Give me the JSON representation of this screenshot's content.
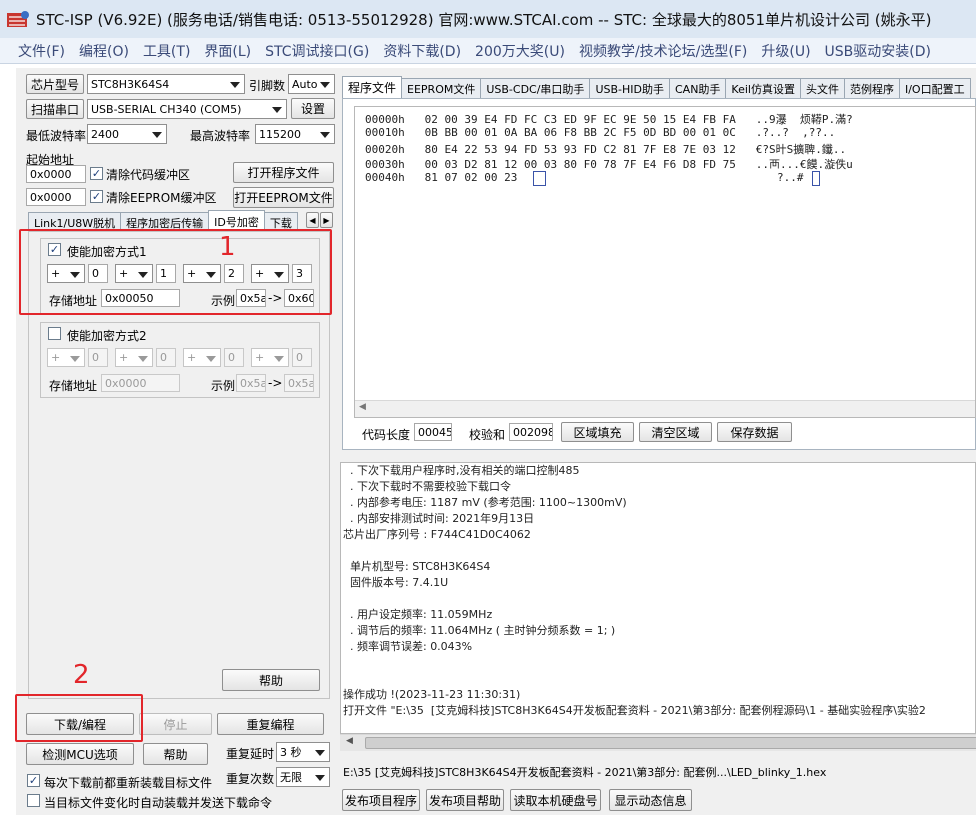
{
  "window": {
    "title": "STC-ISP (V6.92E) (服务电话/销售电话: 0513-55012928) 官网:www.STCAI.com  -- STC: 全球最大的8051单片机设计公司 (姚永平)"
  },
  "menu": [
    "文件(F)",
    "编程(O)",
    "工具(T)",
    "界面(L)",
    "STC调试接口(G)",
    "资料下载(D)",
    "200万大奖(U)",
    "视频教学/技术论坛/选型(F)",
    "升级(U)",
    "USB驱动安装(D)"
  ],
  "left": {
    "chip_label": "芯片型号",
    "chip_value": "STC8H3K64S4",
    "pin_label": "引脚数",
    "pin_value": "Auto",
    "scan_btn": "扫描串口",
    "port_value": "USB-SERIAL CH340 (COM5)",
    "settings_btn": "设置",
    "min_baud_label": "最低波特率",
    "min_baud": "2400",
    "max_baud_label": "最高波特率",
    "max_baud": "115200",
    "start_addr_label": "起始地址",
    "code_addr": "0x0000",
    "clear_code": "清除代码缓冲区",
    "open_prog": "打开程序文件",
    "eeprom_addr": "0x0000",
    "clear_eeprom": "清除EEPROM缓冲区",
    "open_eeprom": "打开EEPROM文件",
    "tabs": [
      "Link1/U8W脱机",
      "程序加密后传输",
      "ID号加密",
      "下载"
    ],
    "enc1": {
      "label": "使能加密方式1",
      "ops": [
        "+",
        "+",
        "+",
        "+"
      ],
      "vals": [
        "0",
        "1",
        "2",
        "3"
      ],
      "addr_label": "存储地址",
      "addr": "0x00050",
      "example_label": "示例",
      "ex_from": "0x5a",
      "arrow": "->",
      "ex_to": "0x60"
    },
    "enc2": {
      "label": "使能加密方式2",
      "ops": [
        "+",
        "+",
        "+",
        "+"
      ],
      "vals": [
        "0",
        "0",
        "0",
        "0"
      ],
      "addr_label": "存储地址",
      "addr": "0x0000",
      "example_label": "示例",
      "ex_from": "0x5a",
      "arrow": "->",
      "ex_to": "0x5a"
    },
    "help_btn": "帮助",
    "download_btn": "下载/编程",
    "stop_btn": "停止",
    "repeat_btn": "重复编程",
    "detect_btn": "检测MCU选项",
    "help2_btn": "帮助",
    "delay_label": "重复延时",
    "delay_value": "3 秒",
    "count_label": "重复次数",
    "count_value": "无限",
    "reload_label": "每次下载前都重新装载目标文件",
    "auto_label": "当目标文件变化时自动装载并发送下载命令"
  },
  "annotations": {
    "one": "1",
    "two": "2"
  },
  "right": {
    "tabs": [
      "程序文件",
      "EEPROM文件",
      "USB-CDC/串口助手",
      "USB-HID助手",
      "CAN助手",
      "Keil仿真设置",
      "头文件",
      "范例程序",
      "I/O口配置工"
    ],
    "hex": [
      {
        "addr": "00000h",
        "bytes": "02 00 39 E4 FD FC C3 ED 9F EC 9E 50 15 E4 FB FA",
        "ascii": "..9瀑  烦鞯P.滿?"
      },
      {
        "addr": "00010h",
        "bytes": "0B BB 00 01 0A BA 06 F8 BB 2C F5 0D BD 00 01 0C",
        "ascii": ".?..?  ,??.."
      },
      {
        "addr": "00020h",
        "bytes": "80 E4 22 53 94 FD 53 93 FD C2 81 7F E8 7E 03 12",
        "ascii": "€?S旪S擴聛.鑯.."
      },
      {
        "addr": "00030h",
        "bytes": "00 03 D2 81 12 00 03 80 F0 78 7F E4 F6 D8 FD 75",
        "ascii": "..襾...€饃.漩佚u"
      },
      {
        "addr": "00040h",
        "bytes": "81 07 02 00 23",
        "ascii": "?..#"
      }
    ],
    "code_len_label": "代码长度",
    "code_len": "00045",
    "checksum_label": "校验和",
    "checksum": "002098",
    "fill_btn": "区域填充",
    "clear_btn": "清空区域",
    "save_btn": "保存数据",
    "log": [
      "  . 下次下载用户程序时,没有相关的端口控制485",
      "  . 下次下载时不需要校验下载口令",
      "  . 内部参考电压: 1187 mV (参考范围: 1100~1300mV)",
      "  . 内部安排测试时间: 2021年9月13日",
      "芯片出厂序列号 : F744C41D0C4062",
      "",
      "  单片机型号: STC8H3K64S4",
      "  固件版本号: 7.4.1U",
      "",
      "  . 用户设定频率: 11.059MHz",
      "  . 调节后的频率: 11.064MHz ( 主时钟分频系数 = 1; )",
      "  . 频率调节误差: 0.043%",
      "",
      "",
      "",
      "操作成功 !(2023-11-23 11:30:31)",
      "打开文件 \"E:\\35  [艾克姆科技]STC8H3K64S4开发板配套资料 - 2021\\第3部分: 配套例程源码\\1 - 基础实验程序\\实验2"
    ],
    "path": "E:\\35  [艾克姆科技]STC8H3K64S4开发板配套资料 - 2021\\第3部分: 配套例...\\LED_blinky_1.hex",
    "bottom_btns": [
      "发布项目程序",
      "发布项目帮助",
      "读取本机硬盘号",
      "显示动态信息"
    ]
  }
}
